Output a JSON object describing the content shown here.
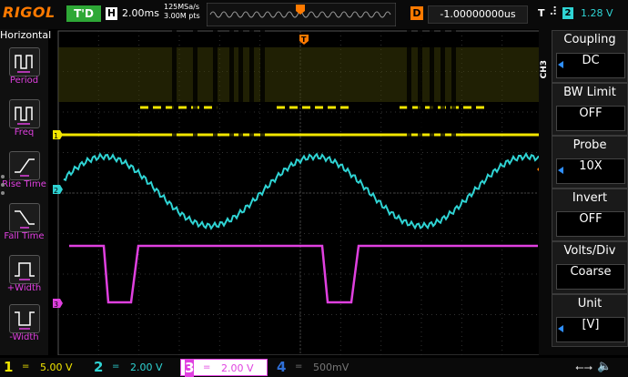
{
  "header": {
    "brand": "RIGOL",
    "trigger_status": "T'D",
    "horizontal_label": "H",
    "timebase": "2.00ms",
    "sample_rate": "125MSa/s",
    "memory_depth": "3.00M pts",
    "delay_label": "D",
    "delay_value": "-1.00000000us",
    "trigger_label": "T",
    "trigger_edge_icon": "rising-edge-icon",
    "trigger_source": "2",
    "trigger_level": "1.28 V"
  },
  "left_menu": {
    "title": "Horizontal",
    "items": [
      {
        "label": "Period",
        "icon": "period-icon"
      },
      {
        "label": "Freq",
        "icon": "frequency-icon"
      },
      {
        "label": "Rise Time",
        "icon": "rise-time-icon"
      },
      {
        "label": "Fall Time",
        "icon": "fall-time-icon"
      },
      {
        "label": "+Width",
        "icon": "positive-width-icon"
      },
      {
        "label": "-Width",
        "icon": "negative-width-icon"
      }
    ]
  },
  "display": {
    "trigger_marker": "T",
    "channel_markers": [
      "1",
      "2",
      "3"
    ],
    "trigger_level_marker": "T"
  },
  "right_menu": {
    "channel": "CH3",
    "items": [
      {
        "title": "Coupling",
        "value": "DC"
      },
      {
        "title": "BW Limit",
        "value": "OFF"
      },
      {
        "title": "Probe",
        "value": "10X"
      },
      {
        "title": "Invert",
        "value": "OFF"
      },
      {
        "title": "Volts/Div",
        "value": "Coarse"
      },
      {
        "title": "Unit",
        "value": "[V]"
      }
    ]
  },
  "channels": [
    {
      "num": "1",
      "coupling": "=",
      "scale": "5.00 V",
      "color": "#f2e600"
    },
    {
      "num": "2",
      "coupling": "=",
      "scale": "2.00 V",
      "color": "#2fd4d4"
    },
    {
      "num": "3",
      "coupling": "=",
      "scale": "2.00 V",
      "color": "#e040e0"
    },
    {
      "num": "4",
      "coupling": "=",
      "scale": "500mV",
      "color": "#2f6fd6"
    }
  ],
  "status_icons": [
    "usb-icon",
    "speaker-icon"
  ],
  "colors": {
    "ch1": "#f2e600",
    "ch2": "#2fd4d4",
    "ch3": "#e040e0",
    "ch4": "#2f6fd6",
    "accent": "#ff7a00",
    "trigger_ok": "#2ea836"
  }
}
